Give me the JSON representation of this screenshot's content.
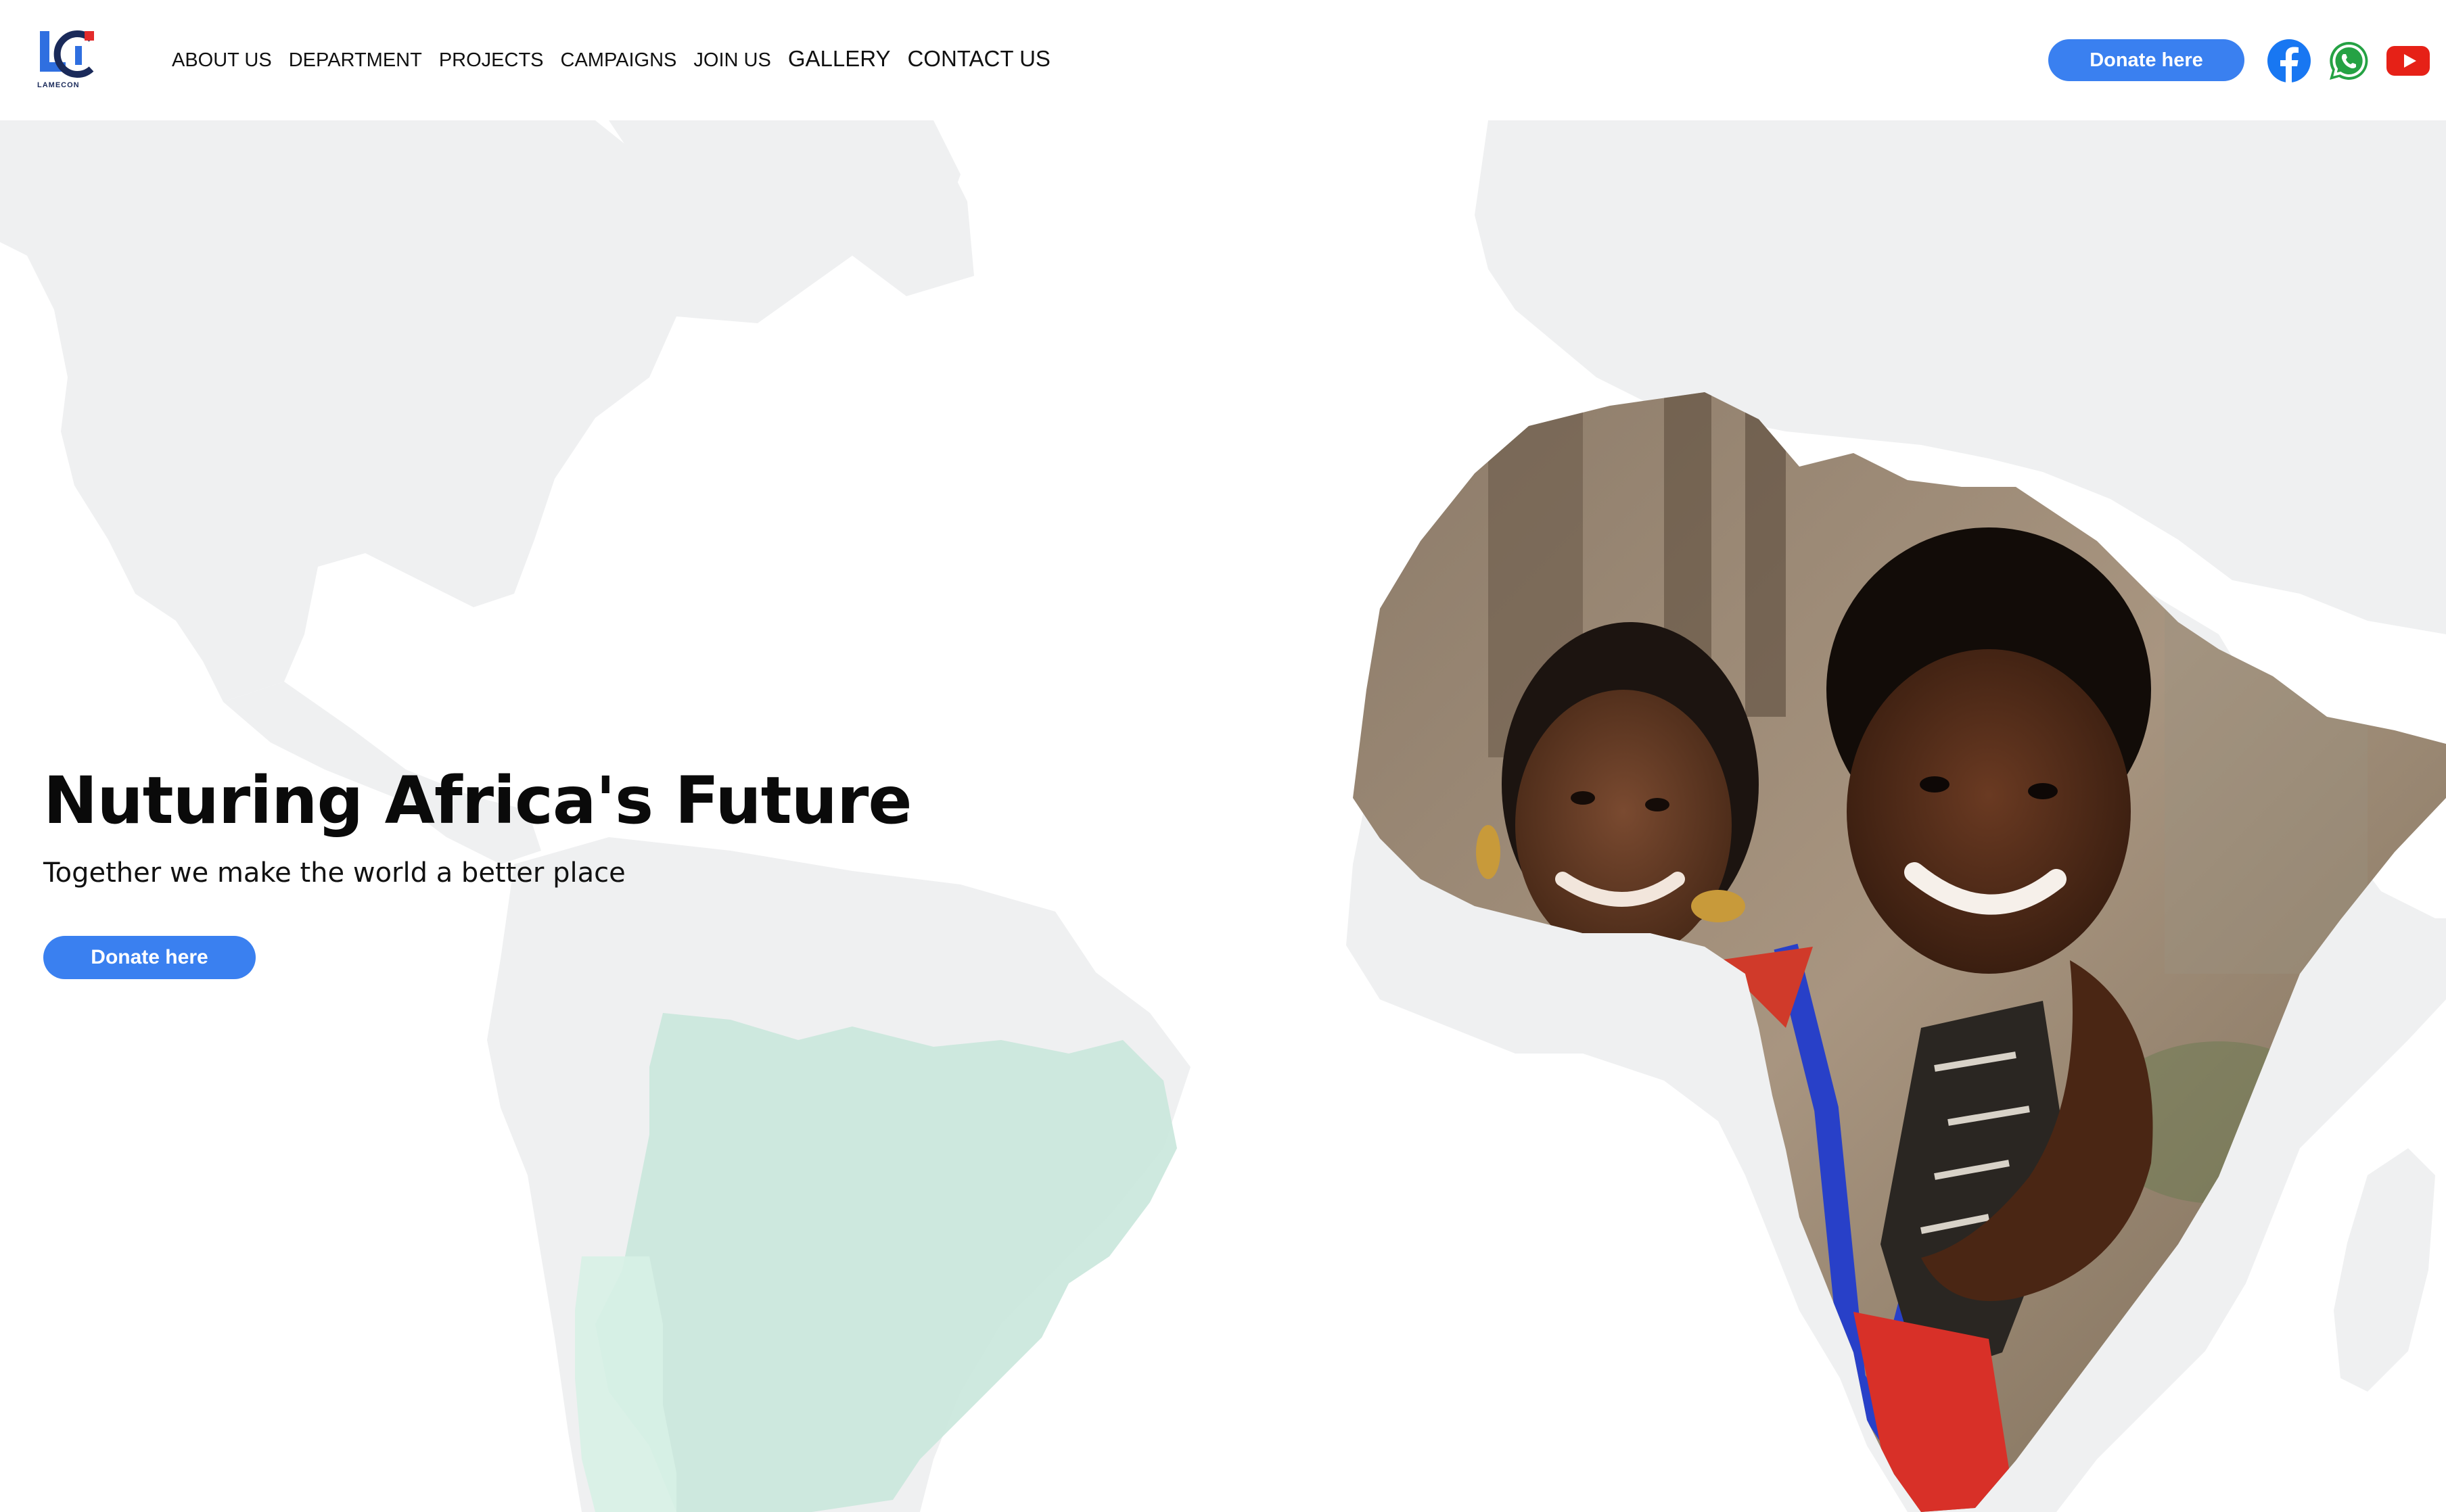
{
  "header": {
    "logo": {
      "icon": "lamecon-logo",
      "caption": "LAMECON"
    },
    "nav": [
      {
        "label": "ABOUT US"
      },
      {
        "label": "DEPARTMENT"
      },
      {
        "label": "PROJECTS"
      },
      {
        "label": "CAMPAIGNS"
      },
      {
        "label": "JOIN US"
      },
      {
        "label": "GALLERY"
      },
      {
        "label": "CONTACT US"
      }
    ],
    "donate_label": "Donate here",
    "social": [
      {
        "icon": "facebook-icon",
        "color": "#1877f2"
      },
      {
        "icon": "whatsapp-icon",
        "color": "#25a244"
      },
      {
        "icon": "youtube-icon",
        "color": "#e62117"
      }
    ]
  },
  "hero": {
    "title": "Nuturing Africa's Future",
    "subtitle": "Together we make the world a better place",
    "donate_label": "Donate here"
  },
  "colors": {
    "accent": "#3a80f0",
    "map_land": "#eff0f1",
    "highlight_region": "#c9e7db",
    "text": "#0a0a0a"
  }
}
